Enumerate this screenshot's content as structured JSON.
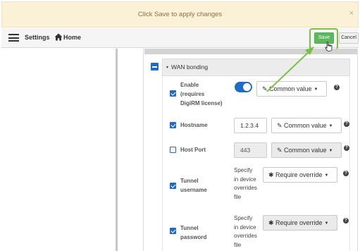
{
  "banner": {
    "message": "Click Save to apply changes",
    "close_glyph": "×"
  },
  "topbar": {
    "settings_label": "Settings",
    "home_label": "Home",
    "save_label": "Save",
    "cancel_label": "Cancel"
  },
  "section": {
    "title": "WAN bonding",
    "caret_glyph": "▾"
  },
  "fields": {
    "enable": {
      "label_line1": "Enable",
      "label_line2": "(requires",
      "label_line3": "DigiRM license)",
      "dropdown": "Common value"
    },
    "hostname": {
      "label": "Hostname",
      "value": "1.2.3.4",
      "dropdown": "Common value"
    },
    "host_port": {
      "label": "Host Port",
      "value": "443",
      "dropdown": "Common value"
    },
    "tunnel_username": {
      "label_line1": "Tunnel",
      "label_line2": "username",
      "text_line1": "Specify",
      "text_line2": "in device",
      "text_line3": "overrides",
      "text_line4": "file",
      "dropdown": "Require override"
    },
    "tunnel_password": {
      "label_line1": "Tunnel",
      "label_line2": "password",
      "text_line1": "Specify",
      "text_line2": "in device",
      "text_line3": "overrides",
      "text_line4": "file",
      "dropdown": "Require override"
    }
  },
  "glyphs": {
    "help": "?",
    "caret": "▼",
    "edit_icon": "✎",
    "asterisk_icon": "✱"
  },
  "colors": {
    "accent": "#1f6cc6",
    "save_green": "#5cb85c",
    "highlight_green": "#7ac043",
    "banner_bg": "#fbf1d6"
  }
}
